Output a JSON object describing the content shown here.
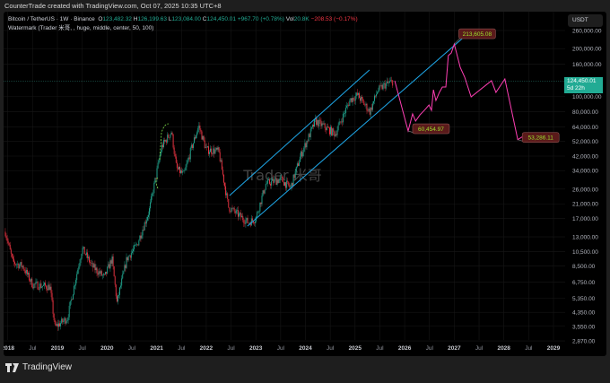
{
  "credit": "CounterTrade created with TradingView.com, Oct 07, 2025 10:35 UTC+8",
  "legend": {
    "symbol": "Bitcoin / TetherUS · 1W · Binance",
    "o_label": "O",
    "o": "123,482.32",
    "h_label": "H",
    "h": "126,199.63",
    "l_label": "L",
    "l": "123,084.00",
    "c_label": "C",
    "c": "124,450.01",
    "change": "+967.70 (+0.78%)",
    "vol_label": "Vol",
    "vol": "20.8K",
    "vol_change": "−208.53 (−0.17%)",
    "indicator": "Watermark (Trader 米哥, , huge, middle, center, 50, 100)"
  },
  "currency": "USDT",
  "price_tag": {
    "price": "124,450.01",
    "countdown": "5d 22h"
  },
  "watermark": "Trader 米哥",
  "footer": {
    "brand": "TradingView"
  },
  "colors": {
    "up": "#22ab94",
    "down": "#f23645",
    "channel": "#1ea7e8",
    "projection": "#ff3fb4",
    "label_bg": "#5a1a1a",
    "label_text": "#9be02d"
  },
  "chart_data": {
    "type": "candlestick",
    "scale": "log",
    "y_ticks": [
      "260,000.00",
      "200,000.00",
      "160,000.00",
      "100,000.00",
      "80,000.00",
      "64,000.00",
      "52,000.00",
      "42,000.00",
      "34,000.00",
      "26,000.00",
      "21,000.00",
      "17,000.00",
      "13,000.00",
      "10,500.00",
      "8,500.00",
      "6,750.00",
      "5,350.00",
      "4,350.00",
      "3,550.00",
      "2,870.00"
    ],
    "x_ticks": [
      "2018",
      "Jul",
      "2019",
      "Jul",
      "2020",
      "Jul",
      "2021",
      "Jul",
      "2022",
      "Jul",
      "2023",
      "Jul",
      "2024",
      "Jul",
      "2025",
      "Jul",
      "2026",
      "Jul",
      "2027",
      "Jul",
      "2028",
      "Jul",
      "2029"
    ],
    "price_path": [
      [
        2017.95,
        14000
      ],
      [
        2018.1,
        9000
      ],
      [
        2018.3,
        8500
      ],
      [
        2018.5,
        6500
      ],
      [
        2018.85,
        6300
      ],
      [
        2018.95,
        3500
      ],
      [
        2019.2,
        4000
      ],
      [
        2019.5,
        11000
      ],
      [
        2019.7,
        8500
      ],
      [
        2019.95,
        7200
      ],
      [
        2020.1,
        9500
      ],
      [
        2020.2,
        5000
      ],
      [
        2020.4,
        9500
      ],
      [
        2020.6,
        11500
      ],
      [
        2020.85,
        19000
      ],
      [
        2021.0,
        33000
      ],
      [
        2021.1,
        48000
      ],
      [
        2021.3,
        60000
      ],
      [
        2021.4,
        35000
      ],
      [
        2021.55,
        32000
      ],
      [
        2021.7,
        47000
      ],
      [
        2021.85,
        65000
      ],
      [
        2022.0,
        46000
      ],
      [
        2022.25,
        45000
      ],
      [
        2022.45,
        20000
      ],
      [
        2022.85,
        16000
      ],
      [
        2023.0,
        17000
      ],
      [
        2023.2,
        28000
      ],
      [
        2023.5,
        30000
      ],
      [
        2023.7,
        26500
      ],
      [
        2023.9,
        42000
      ],
      [
        2024.2,
        70000
      ],
      [
        2024.6,
        58000
      ],
      [
        2024.9,
        95000
      ],
      [
        2025.05,
        102000
      ],
      [
        2025.3,
        80000
      ],
      [
        2025.45,
        108000
      ],
      [
        2025.6,
        118000
      ],
      [
        2025.77,
        124450
      ]
    ],
    "last_price": 124450.01,
    "channel": {
      "upper": [
        [
          2022.47,
          23700
        ],
        [
          2025.29,
          146600
        ]
      ],
      "lower": [
        [
          2022.83,
          15200
        ],
        [
          2027.16,
          231200
        ]
      ]
    },
    "projection": [
      [
        2025.8,
        125400
      ],
      [
        2026.07,
        60455
      ],
      [
        2026.16,
        77500
      ],
      [
        2026.22,
        69800
      ],
      [
        2026.31,
        76500
      ],
      [
        2026.38,
        80600
      ],
      [
        2026.43,
        83800
      ],
      [
        2026.49,
        88200
      ],
      [
        2026.54,
        81600
      ],
      [
        2026.58,
        110000
      ],
      [
        2026.63,
        94100
      ],
      [
        2026.7,
        105900
      ],
      [
        2026.76,
        114500
      ],
      [
        2026.83,
        114500
      ],
      [
        2026.88,
        180500
      ],
      [
        2026.94,
        187700
      ],
      [
        2027.0,
        213605
      ],
      [
        2027.12,
        152400
      ],
      [
        2027.21,
        132100
      ],
      [
        2027.34,
        99200
      ],
      [
        2027.75,
        125400
      ],
      [
        2027.84,
        105900
      ],
      [
        2028.02,
        128700
      ],
      [
        2028.28,
        53286
      ],
      [
        2028.37,
        55500
      ]
    ],
    "price_labels": [
      {
        "text": "213,605.08",
        "date": 2027.0,
        "price": 213605
      },
      {
        "text": "60,454.97",
        "date": 2026.07,
        "price": 60455
      },
      {
        "text": "53,286.11",
        "date": 2028.28,
        "price": 53286
      }
    ]
  }
}
